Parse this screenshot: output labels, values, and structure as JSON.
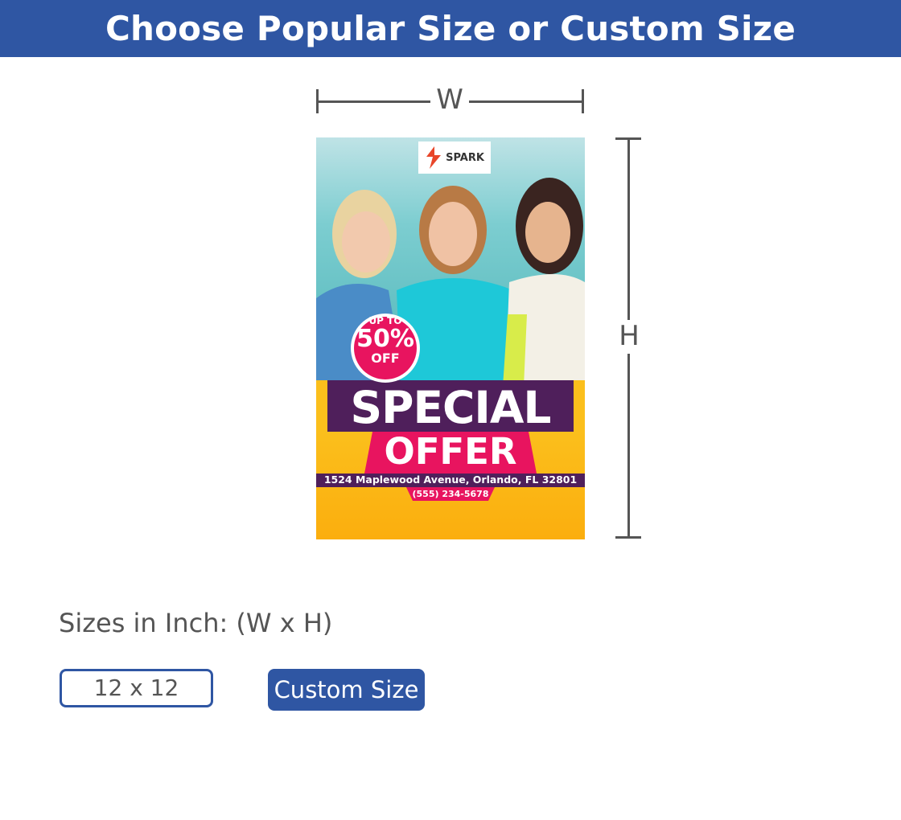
{
  "header": {
    "title": "Choose Popular Size or Custom Size"
  },
  "dimensions": {
    "width_label": "W",
    "height_label": "H"
  },
  "poster": {
    "brand": "SPARK",
    "badge_line1": "UP TO",
    "badge_line2": "50%",
    "badge_line3": "OFF",
    "headline": "SPECIAL",
    "subheadline": "OFFER",
    "address": "1524 Maplewood Avenue, Orlando, FL 32801",
    "phone": "(555) 234-5678"
  },
  "sizes": {
    "label": "Sizes in Inch: (W x H)",
    "options": [
      {
        "label": "12 x 12"
      }
    ],
    "custom_button": "Custom Size"
  },
  "colors": {
    "brand_blue": "#2f56a3",
    "accent_pink": "#e8145f",
    "accent_purple": "#4f1f5b",
    "accent_yellow": "#fbb414"
  }
}
